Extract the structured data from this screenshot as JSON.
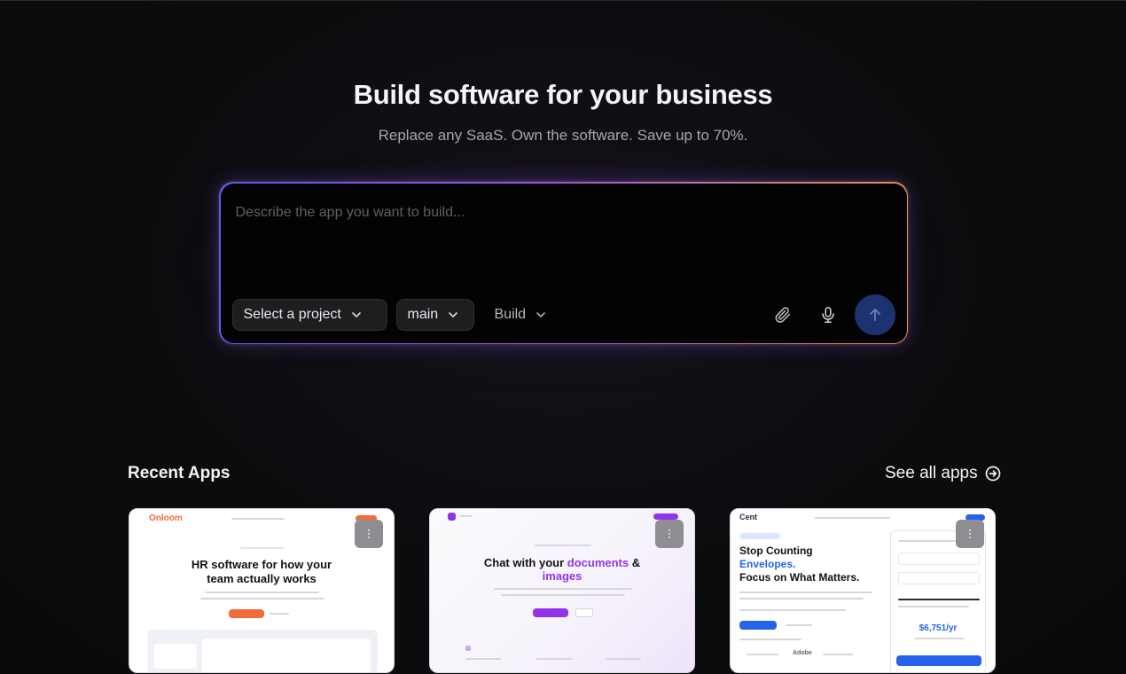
{
  "hero": {
    "title": "Build software for your business",
    "subtitle": "Replace any SaaS. Own the software. Save up to 70%."
  },
  "prompt": {
    "placeholder": "Describe the app you want to build...",
    "project_select": "Select a project",
    "branch_select": "main",
    "mode_select": "Build"
  },
  "recent": {
    "title": "Recent Apps",
    "see_all": "See all apps"
  },
  "cards": [
    {
      "logo": "Onloom",
      "title_line1": "HR software for how your",
      "title_line2": "team actually works"
    },
    {
      "title_plain": "Chat with your ",
      "title_accent": "documents",
      "title_amp": " &",
      "title_accent2": "images"
    },
    {
      "logo": "Cent",
      "heading1": "Stop Counting",
      "heading_accent": "Envelopes.",
      "heading3": "Focus on What Matters.",
      "price": "$6,751/yr",
      "brand1": "Adobe"
    }
  ],
  "colors": {
    "send_button": "#1d3370",
    "accent_purple": "#9333ea",
    "accent_blue": "#2563eb",
    "onloom_orange": "#f26b3a"
  }
}
